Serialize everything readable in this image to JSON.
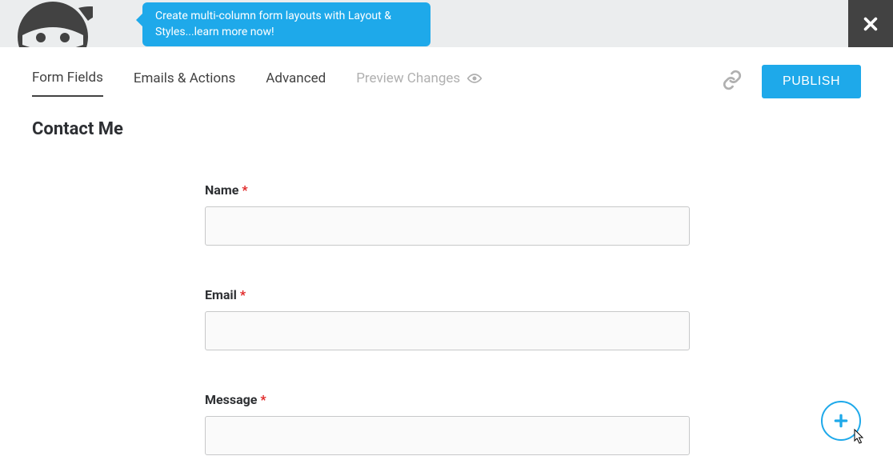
{
  "header": {
    "tooltip_text": "Create multi-column form layouts with Layout & Styles...learn more now!"
  },
  "tabs": {
    "form_fields": "Form Fields",
    "emails_actions": "Emails & Actions",
    "advanced": "Advanced",
    "preview_changes": "Preview Changes"
  },
  "actions": {
    "publish_label": "PUBLISH"
  },
  "form": {
    "title": "Contact Me",
    "fields": {
      "name_label": "Name",
      "email_label": "Email",
      "message_label": "Message",
      "required_star": "*"
    }
  }
}
